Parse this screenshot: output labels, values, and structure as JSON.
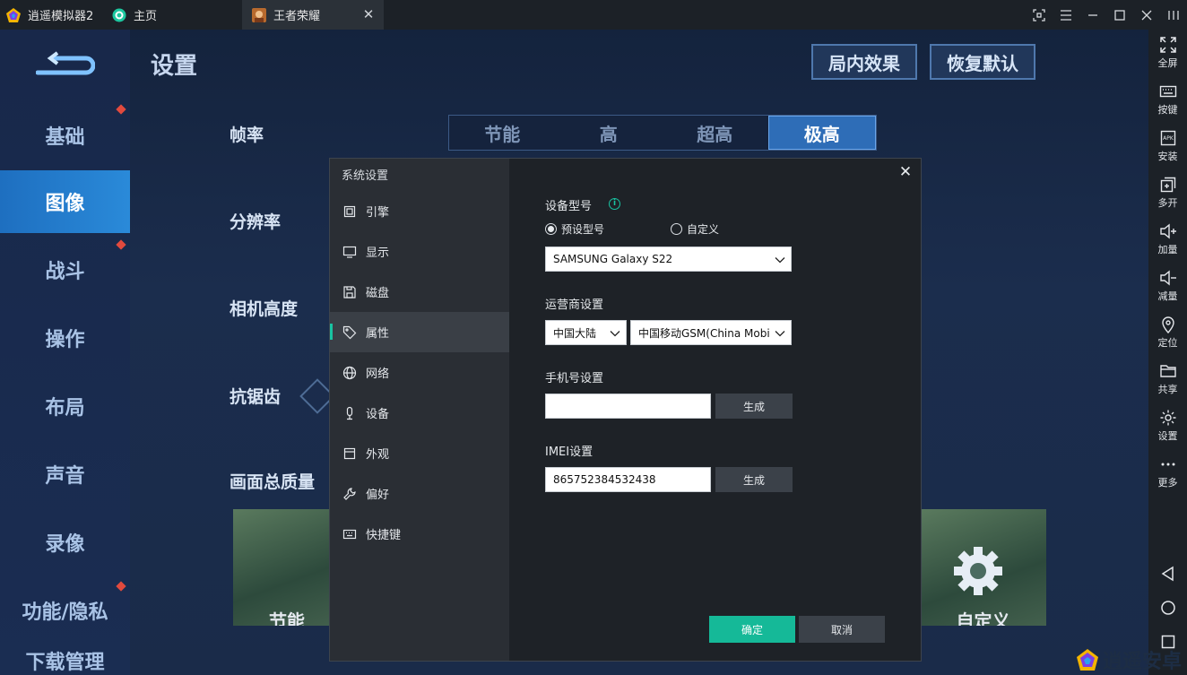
{
  "titlebar": {
    "tabs": [
      {
        "label": "逍遥模拟器2"
      },
      {
        "label": "主页"
      },
      {
        "label": "王者荣耀"
      }
    ]
  },
  "rightbar": {
    "items": [
      {
        "label": "全屏",
        "icon": "fullscreen-icon"
      },
      {
        "label": "按键",
        "icon": "keyboard-icon"
      },
      {
        "label": "安装",
        "icon": "apk-icon"
      },
      {
        "label": "多开",
        "icon": "multi-instance-icon"
      },
      {
        "label": "加量",
        "icon": "volume-up-icon"
      },
      {
        "label": "减量",
        "icon": "volume-down-icon"
      },
      {
        "label": "定位",
        "icon": "location-icon"
      },
      {
        "label": "共享",
        "icon": "folder-icon"
      },
      {
        "label": "设置",
        "icon": "gear-icon"
      },
      {
        "label": "更多",
        "icon": "more-icon"
      }
    ]
  },
  "game": {
    "title": "设置",
    "btn_effect": "局内效果",
    "btn_reset": "恢复默认",
    "side_items": [
      "基础",
      "图像",
      "战斗",
      "操作",
      "布局",
      "声音",
      "录像",
      "功能/隐私",
      "下载管理"
    ],
    "labels": {
      "framerate": "帧率",
      "resolution": "分辨率",
      "camera": "相机高度",
      "antialias": "抗锯齿",
      "quality": "画面总质量"
    },
    "framerate_options": [
      "节能",
      "高",
      "超高",
      "极高"
    ],
    "framerate_selected": "极高",
    "thumb_left": "节能",
    "thumb_right": "自定义"
  },
  "dialog": {
    "title": "系统设置",
    "nav": [
      {
        "label": "引擎",
        "icon": "chip-icon"
      },
      {
        "label": "显示",
        "icon": "monitor-icon"
      },
      {
        "label": "磁盘",
        "icon": "disk-icon"
      },
      {
        "label": "属性",
        "icon": "tag-icon"
      },
      {
        "label": "网络",
        "icon": "globe-icon"
      },
      {
        "label": "设备",
        "icon": "microphone-icon"
      },
      {
        "label": "外观",
        "icon": "window-icon"
      },
      {
        "label": "偏好",
        "icon": "wrench-icon"
      },
      {
        "label": "快捷键",
        "icon": "keyboard-icon"
      }
    ],
    "active_nav": "属性",
    "device_model": {
      "title": "设备型号",
      "radio_preset": "预设型号",
      "radio_custom": "自定义",
      "selected_radio": "预设型号",
      "model_value": "SAMSUNG Galaxy S22"
    },
    "carrier": {
      "title": "运营商设置",
      "region_value": "中国大陆",
      "carrier_value": "中国移动GSM(China Mobi"
    },
    "phone": {
      "title": "手机号设置",
      "value": "",
      "generate": "生成"
    },
    "imei": {
      "title": "IMEI设置",
      "value": "865752384532438",
      "generate": "生成"
    },
    "ok": "确定",
    "cancel": "取消"
  },
  "watermark": "逍遥安卓",
  "colors": {
    "accent": "#19c3a2",
    "titlebar_bg": "#1c2127",
    "dialog_bg": "#1e2227",
    "dialog_nav_bg": "#2a2e34"
  }
}
